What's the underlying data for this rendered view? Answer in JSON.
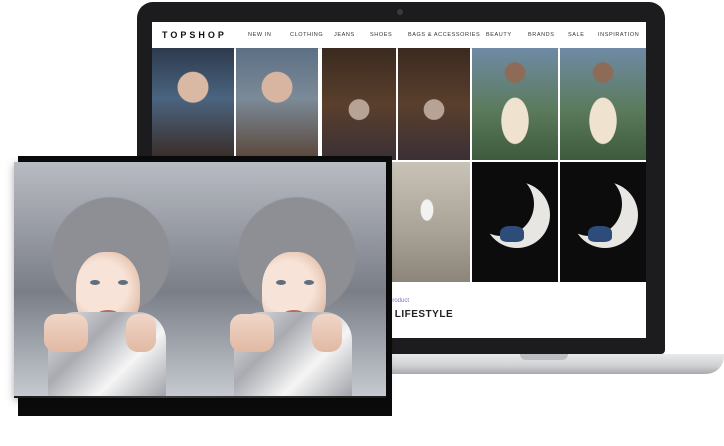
{
  "site": {
    "logo": "TOPSHOP",
    "nav_items": [
      "NEW IN",
      "CLOTHING",
      "JEANS",
      "SHOES",
      "BAGS & ACCESSORIES",
      "BEAUTY",
      "BRANDS",
      "SALE",
      "INSPIRATION"
    ]
  },
  "promo": {
    "cta_fragment": "r your product",
    "headline_fragment": "UR LIFESTYLE"
  },
  "colors": {
    "cta_text": "#7b6fd1",
    "laptop_frame": "#1c1c1e"
  },
  "icons": {
    "camera": "webcam-dot"
  }
}
